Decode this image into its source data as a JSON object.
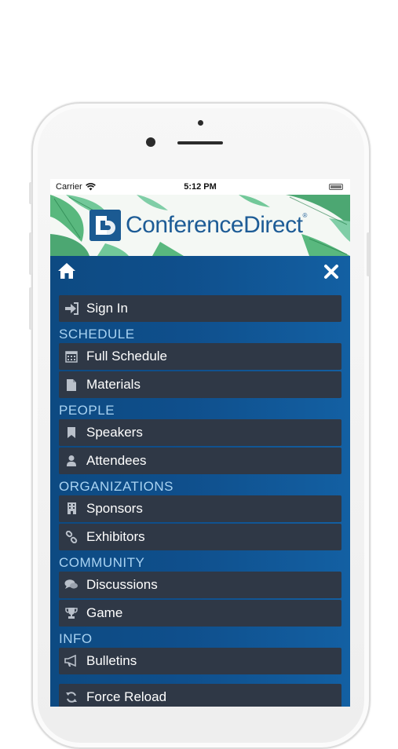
{
  "status_bar": {
    "carrier": "Carrier",
    "time": "5:12 PM"
  },
  "banner": {
    "brand": "ConferenceDirect",
    "registered_mark": "®"
  },
  "nav": {
    "home_icon": "home-icon",
    "close_icon": "close-icon"
  },
  "menu": {
    "sign_in": "Sign In",
    "sections": [
      {
        "title": "SCHEDULE",
        "items": [
          "Full Schedule",
          "Materials"
        ]
      },
      {
        "title": "PEOPLE",
        "items": [
          "Speakers",
          "Attendees"
        ]
      },
      {
        "title": "ORGANIZATIONS",
        "items": [
          "Sponsors",
          "Exhibitors"
        ]
      },
      {
        "title": "COMMUNITY",
        "items": [
          "Discussions",
          "Game"
        ]
      },
      {
        "title": "INFO",
        "items": [
          "Bulletins"
        ]
      }
    ],
    "force_reload": "Force Reload"
  },
  "colors": {
    "menu_item_bg": "#2f3846",
    "nav_bg": "#0f4f8c",
    "section_header": "#a9d3f2",
    "brand": "#1d5c96"
  }
}
